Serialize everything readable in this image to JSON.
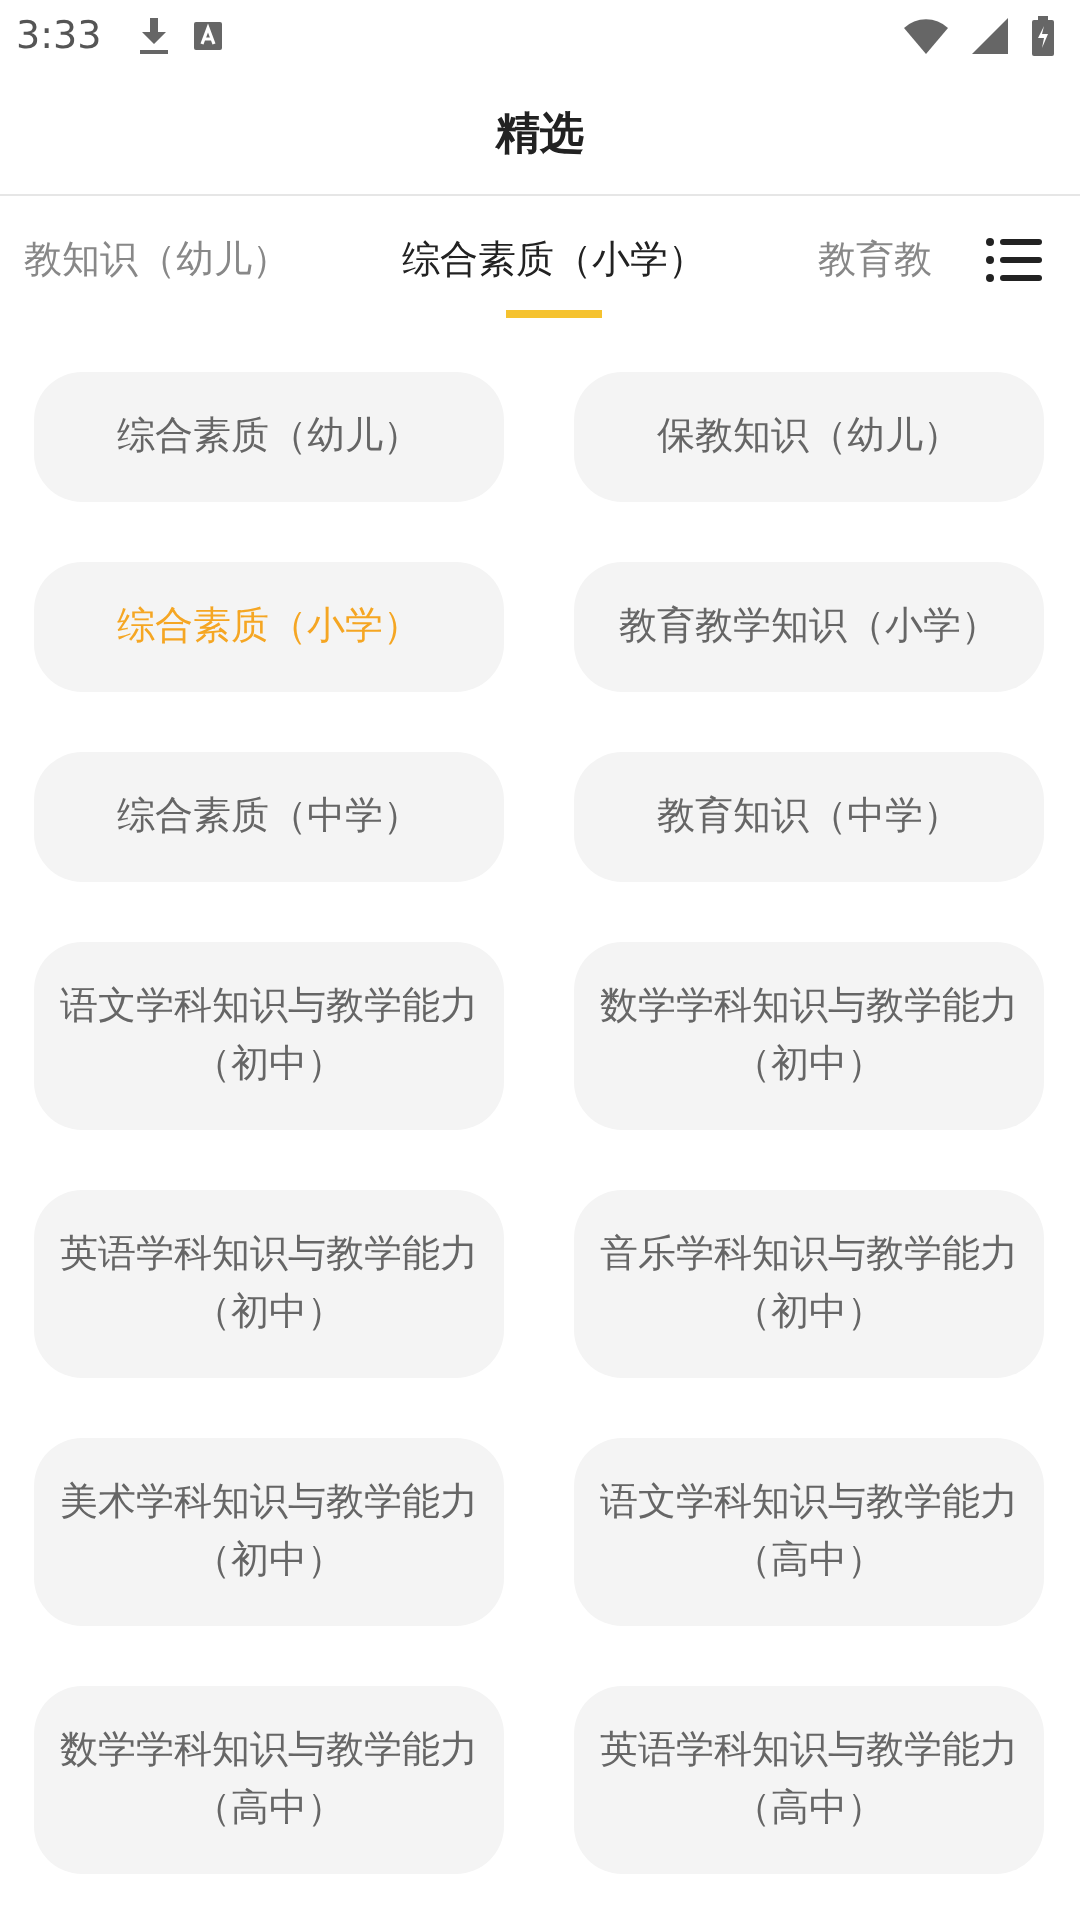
{
  "status_bar": {
    "time": "3:33"
  },
  "header": {
    "title": "精选"
  },
  "tabs": [
    {
      "label": "教知识（幼儿）",
      "selected": false
    },
    {
      "label": "综合素质（小学）",
      "selected": true
    },
    {
      "label": "教育教",
      "selected": false
    }
  ],
  "subjects": [
    {
      "label": "综合素质（幼儿）",
      "selected": false
    },
    {
      "label": "保教知识（幼儿）",
      "selected": false
    },
    {
      "label": "综合素质（小学）",
      "selected": true
    },
    {
      "label": "教育教学知识（小学）",
      "selected": false
    },
    {
      "label": "综合素质（中学）",
      "selected": false
    },
    {
      "label": "教育知识（中学）",
      "selected": false
    },
    {
      "label": "语文学科知识与教学能力（初中）",
      "selected": false
    },
    {
      "label": "数学学科知识与教学能力（初中）",
      "selected": false
    },
    {
      "label": "英语学科知识与教学能力（初中）",
      "selected": false
    },
    {
      "label": "音乐学科知识与教学能力（初中）",
      "selected": false
    },
    {
      "label": "美术学科知识与教学能力（初中）",
      "selected": false
    },
    {
      "label": "语文学科知识与教学能力（高中）",
      "selected": false
    },
    {
      "label": "数学学科知识与教学能力（高中）",
      "selected": false
    },
    {
      "label": "英语学科知识与教学能力（高中）",
      "selected": false
    }
  ]
}
